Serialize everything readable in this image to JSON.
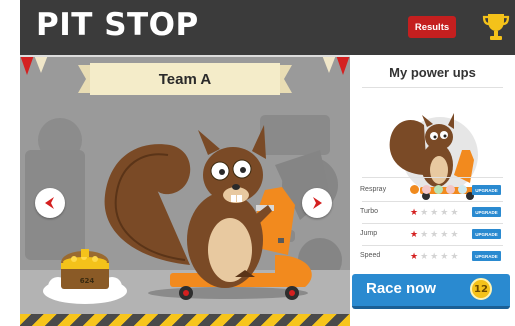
{
  "header": {
    "title": "PIT STOP",
    "results_label": "Results",
    "trophy_icon": "trophy-icon"
  },
  "stage": {
    "team_name": "Team A",
    "character": "squirrel on orange scooter",
    "coins": "624",
    "left_arrow_icon": "chevron-left-icon",
    "right_arrow_icon": "chevron-right-icon"
  },
  "panel": {
    "title": "My power ups",
    "rows": [
      {
        "label": "Respray",
        "type": "swatches",
        "colors": [
          "#f08a1e",
          "#f2c7c7",
          "#b9e3b4",
          "#f2c7c7",
          "#cfe9ee"
        ],
        "button": "UPGRADE"
      },
      {
        "label": "Turbo",
        "type": "stars",
        "rating": 1,
        "max": 5,
        "button": "UPGRADE"
      },
      {
        "label": "Jump",
        "type": "stars",
        "rating": 1,
        "max": 5,
        "button": "UPGRADE"
      },
      {
        "label": "Speed",
        "type": "stars",
        "rating": 1,
        "max": 5,
        "button": "UPGRADE"
      }
    ],
    "race_label": "Race now",
    "race_cost": "12"
  },
  "colors": {
    "header_bg": "#3b3b3b",
    "results_red": "#c41f1f",
    "accent_blue": "#2a8ad0",
    "scooter_orange": "#f28a1e",
    "squirrel_brown": "#7a4a26",
    "coin_gold": "#f4c21a"
  }
}
